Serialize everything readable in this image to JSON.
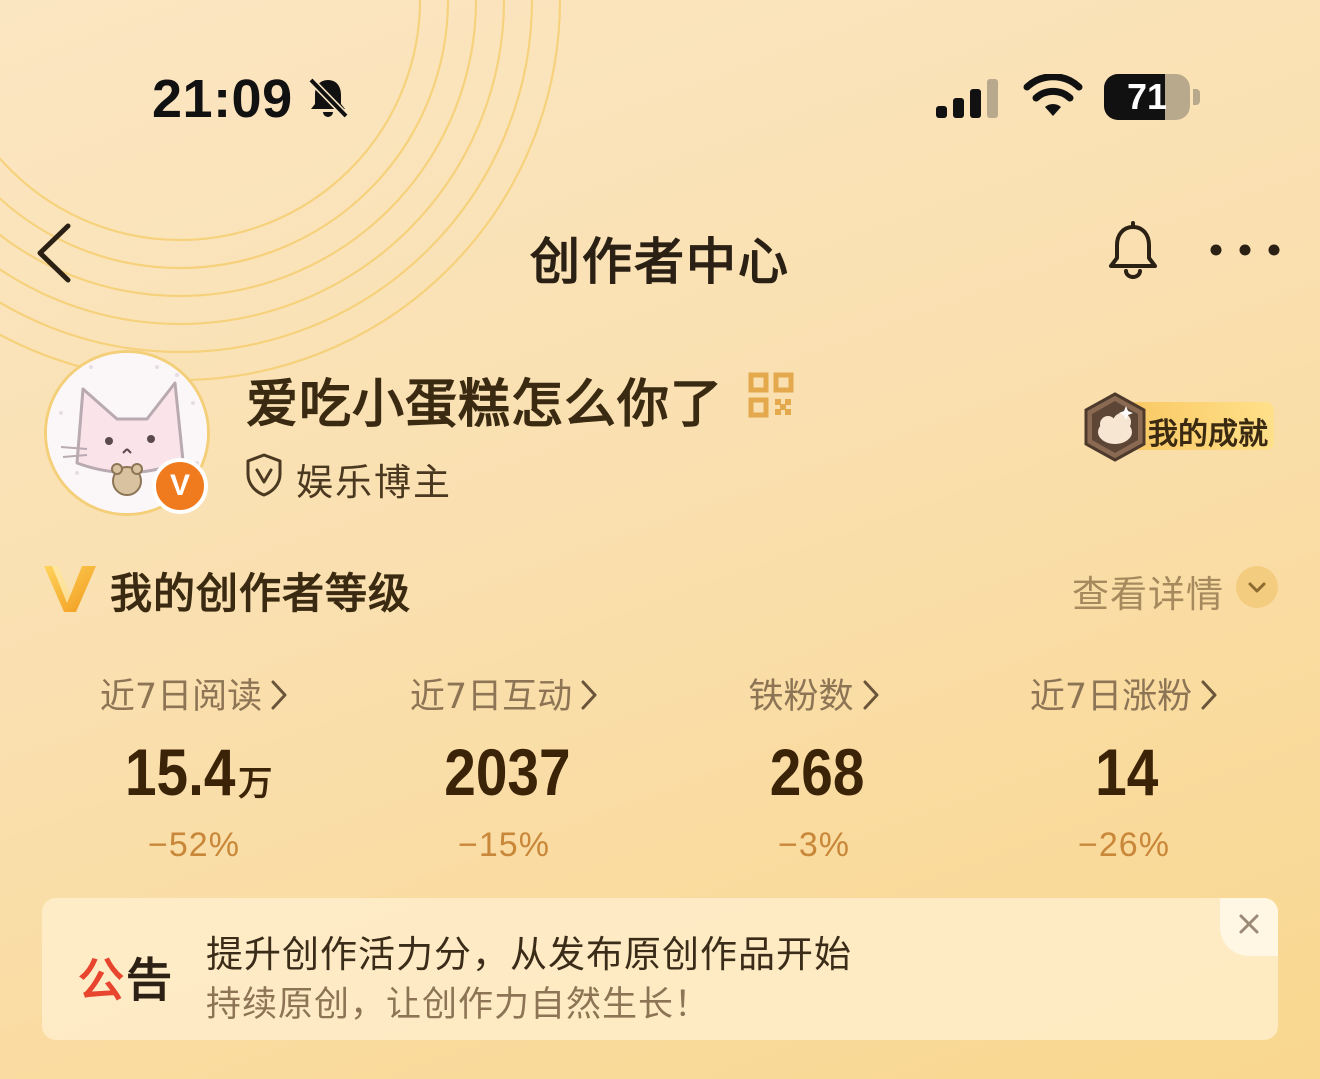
{
  "status_bar": {
    "time": "21:09",
    "battery_level": "71",
    "battery_fraction": 0.71
  },
  "nav": {
    "title": "创作者中心"
  },
  "profile": {
    "name": "爱吃小蛋糕怎么你了",
    "tag": "娱乐博主",
    "achievement_label": "我的成就"
  },
  "level": {
    "title": "我的创作者等级",
    "detail_label": "查看详情"
  },
  "stats": [
    {
      "label": "近7日阅读",
      "value": "15.4",
      "unit": "万",
      "change": "−52%"
    },
    {
      "label": "近7日互动",
      "value": "2037",
      "unit": "",
      "change": "−15%"
    },
    {
      "label": "铁粉数",
      "value": "268",
      "unit": "",
      "change": "−3%"
    },
    {
      "label": "近7日涨粉",
      "value": "14",
      "unit": "",
      "change": "−26%"
    }
  ],
  "notice": {
    "badge_part1": "公",
    "badge_part2": "告",
    "line1": "提升创作活力分，从发布原创作品开始",
    "line2": "持续原创，让创作力自然生长！"
  },
  "colors": {
    "accent_orange": "#f07a1e",
    "change_text": "#c9873a",
    "notice_red": "#e8452e"
  }
}
